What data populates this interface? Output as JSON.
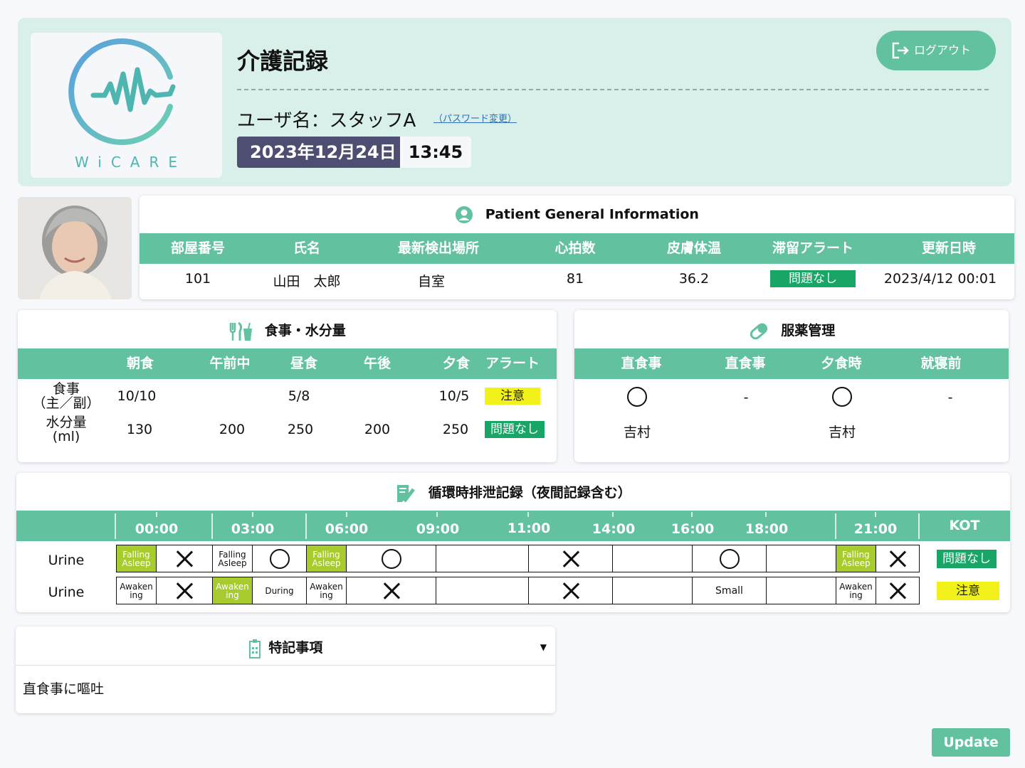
{
  "header": {
    "logo_text": "WiCARE",
    "title": "介護記録",
    "user_label": "ユーザ名：スタッフA",
    "password_link": "（パスワード変更）",
    "date": "2023年12月24日",
    "time": "13:45",
    "logout_label": "ログアウト"
  },
  "patient": {
    "title": "Patient General Information",
    "headers": [
      "部屋番号",
      "氏名",
      "最新検出場所",
      "心拍数",
      "皮膚体温",
      "滞留アラート",
      "更新日時"
    ],
    "room": "101",
    "name": "山田　太郎",
    "location": "自室",
    "heart_rate": "81",
    "skin_temp": "36.2",
    "alert": "問題なし",
    "updated": "2023/4/12 00:01"
  },
  "meal": {
    "title": "食事・水分量",
    "headers": [
      "朝食",
      "午前中",
      "昼食",
      "午後",
      "夕食",
      "アラート"
    ],
    "row1_label_a": "食事",
    "row1_label_b": "（主／副）",
    "row1": {
      "breakfast": "10/10",
      "lunch": "5/8",
      "dinner": "10/5",
      "alert": "注意"
    },
    "row2_label_a": "水分量",
    "row2_label_b": "(ml)",
    "row2": {
      "breakfast": "130",
      "morning": "200",
      "lunch": "250",
      "afternoon": "200",
      "dinner": "250",
      "alert": "問題なし"
    }
  },
  "medication": {
    "title": "服薬管理",
    "headers": [
      "直食事",
      "直食事",
      "夕食時",
      "就寝前"
    ],
    "dash1": "-",
    "dash2": "-",
    "staff1": "吉村",
    "staff2": "吉村"
  },
  "excretion": {
    "title": "循環時排泄記録（夜間記録含む）",
    "times": [
      "00:00",
      "03:00",
      "06:00",
      "09:00",
      "11:00",
      "14:00",
      "16:00",
      "18:00",
      "21:00"
    ],
    "kot": "KOT",
    "row1_label": "Urine",
    "row2_label": "Urine",
    "falling_a": "Falling",
    "falling_b": "Asleep",
    "awaken_a": "Awaken",
    "awaken_b": "ing",
    "during": "During",
    "small": "Small",
    "row1_status": "問題なし",
    "row2_status": "注意"
  },
  "notes": {
    "title": "特記事項",
    "body": "直食事に嘔吐"
  },
  "update_label": "Update",
  "colors": {
    "accent": "#62c2a0",
    "header_bg": "#d9efe9",
    "date_bg": "#4e4e73",
    "ok": "#18a566",
    "warn": "#f2f21a",
    "lime": "#a8cb2d"
  }
}
